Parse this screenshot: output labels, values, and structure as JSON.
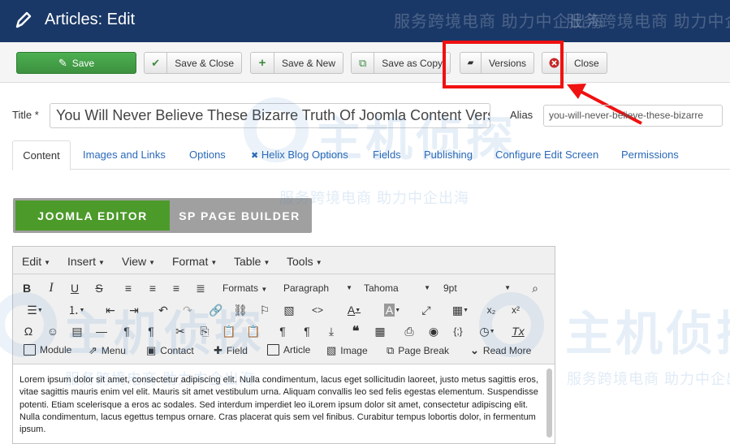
{
  "header": {
    "title": "Articles: Edit"
  },
  "toolbar": {
    "save": "Save",
    "save_close": "Save & Close",
    "save_new": "Save & New",
    "save_copy": "Save as Copy",
    "versions": "Versions",
    "close": "Close"
  },
  "form": {
    "title_label": "Title *",
    "title_value": "You Will Never Believe These Bizarre Truth Of Joomla Content Vers",
    "alias_label": "Alias",
    "alias_value": "you-will-never-believe-these-bizarre"
  },
  "tabs": [
    "Content",
    "Images and Links",
    "Options",
    "Helix Blog Options",
    "Fields",
    "Publishing",
    "Configure Edit Screen",
    "Permissions"
  ],
  "editor_switch": {
    "joomla": "JOOMLA EDITOR",
    "sp": "SP PAGE BUILDER"
  },
  "editor": {
    "menus": [
      "Edit",
      "Insert",
      "View",
      "Format",
      "Table",
      "Tools"
    ],
    "formats": "Formats",
    "block": "Paragraph",
    "font": "Tahoma",
    "size": "9pt",
    "plugins": [
      "Module",
      "Menu",
      "Contact",
      "Field",
      "Article",
      "Image",
      "Page Break",
      "Read More"
    ],
    "body": "Lorem ipsum dolor sit amet, consectetur adipiscing elit. Nulla condimentum, lacus eget sollicitudin laoreet, justo metus sagittis eros, vitae sagittis mauris enim vel elit. Mauris sit amet vestibulum urna. Aliquam convallis leo sed felis egestas elementum. Suspendisse potenti. Etiam scelerisque a eros ac sodales. Sed interdum imperdiet leo iLorem ipsum dolor sit amet, consectetur adipiscing elit. Nulla condimentum, lacus egettus tempus ornare. Cras placerat quis sem vel finibus. Curabitur tempus lobortis dolor, in fermentum ipsum."
  },
  "watermark": {
    "line": "服务跨境电商 助力中企出海",
    "brand": "主机侦探"
  },
  "colors": {
    "header_bg": "#1a3867",
    "save_green": "#4caf50",
    "joomla_green": "#4c9a2a",
    "link_blue": "#2a69b8",
    "highlight_red": "#f01111"
  }
}
